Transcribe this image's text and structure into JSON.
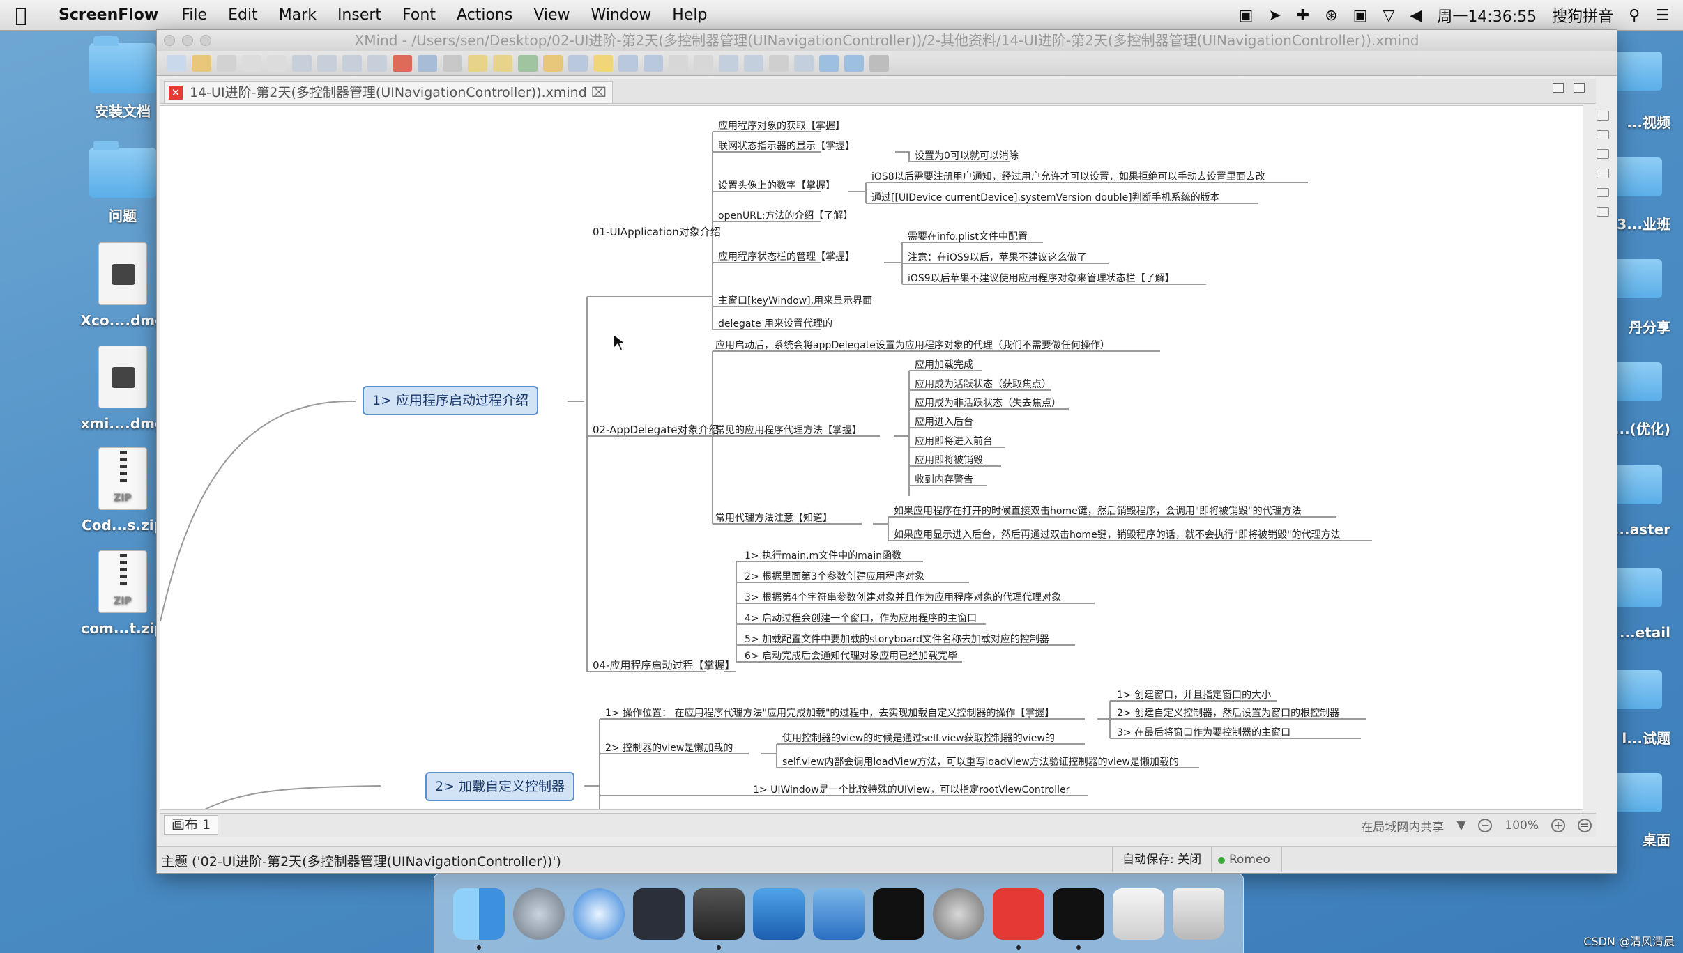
{
  "menubar": {
    "app_name": "ScreenFlow",
    "items": [
      "File",
      "Edit",
      "Mark",
      "Insert",
      "Font",
      "Actions",
      "View",
      "Window",
      "Help"
    ],
    "clock": "周一14:36:55",
    "input_method": "搜狗拼音"
  },
  "desktop": {
    "left_icons": [
      "安装文档",
      "问题",
      "Xco....dmg",
      "xmi....dmg",
      "Cod...s.zip",
      "com...t.zip"
    ],
    "right_labels": [
      "...视频",
      "3...业班",
      "丹分享",
      "...(优化)",
      "...aster",
      "...etail",
      "l...试题",
      "桌面"
    ]
  },
  "window": {
    "title": "XMind - /Users/sen/Desktop/02-UI进阶-第2天(多控制器管理(UINavigationController))/2-其他资料/14-UI进阶-第2天(多控制器管理(UINavigationController)).xmind",
    "tab": "14-UI进阶-第2天(多控制器管理(UINavigationController)).xmind"
  },
  "mindmap": {
    "topic1": "1> 应用程序启动过程介绍",
    "topic2": "2> 加载自定义控制器",
    "b01": "01-UIApplication对象介绍",
    "b01_items": [
      "应用程序对象的获取【掌握】",
      "联网状态指示器的显示【掌握】",
      "设置头像上的数字【掌握】",
      "openURL:方法的介绍【了解】",
      "应用程序状态栏的管理【掌握】",
      "主窗口[keyWindow],用来显示界面",
      "delegate 用来设置代理的"
    ],
    "b01_sub_net": "设置为0可以就可以消除",
    "b01_sub_badge": [
      "iOS8以后需要注册用户通知，经过用户允许才可以设置，如果拒绝可以手动去设置里面去改",
      "通过[[UIDevice currentDevice].systemVersion double]判断手机系统的版本"
    ],
    "b01_sub_status": [
      "需要在info.plist文件中配置",
      "注意：在iOS9以后，苹果不建议这么做了",
      "iOS9以后苹果不建议使用应用程序对象来管理状态栏【了解】"
    ],
    "b02": "02-AppDelegate对象介绍",
    "b02_top": "应用启动后，系统会将appDelegate设置为应用程序对象的代理（我们不需要做任何操作）",
    "b02_common": "常见的应用程序代理方法【掌握】",
    "b02_common_items": [
      "应用加载完成",
      "应用成为活跃状态（获取焦点）",
      "应用成为非活跃状态（失去焦点）",
      "应用进入后台",
      "应用即将进入前台",
      "应用即将被销毁",
      "收到内存警告"
    ],
    "b02_note": "常用代理方法注意【知道】",
    "b02_note_items": [
      "如果应用程序在打开的时候直接双击home键，然后销毁程序，会调用\"即将被销毁\"的代理方法",
      "如果应用显示进入后台，然后再通过双击home键，销毁程序的话，就不会执行\"即将被销毁\"的代理方法"
    ],
    "b04": "04-应用程序启动过程【掌握】",
    "b04_items": [
      "1> 执行main.m文件中的main函数",
      "2> 根据里面第3个参数创建应用程序对象",
      "3> 根据第4个字符串参数创建对象并且作为应用程序对象的代理代理对象",
      "4> 启动过程会创建一个窗口，作为应用程序的主窗口",
      "5> 加载配置文件中要加载的storyboard文件名称去加载对应的控制器",
      "6> 启动完成后会通知代理对象应用已经加载完毕"
    ],
    "t2_pos": "1> 操作位置：  在应用程序代理方法\"应用完成加载\"的过程中，去实现加载自定义控制器的操作【掌握】",
    "t2_pos_items": [
      "1> 创建窗口，并且指定窗口的大小",
      "2> 创建自定义控制器，然后设置为窗口的根控制器",
      "3> 在最后将窗口作为要控制器的主窗口"
    ],
    "t2_lazy": "2> 控制器的view是懒加载的",
    "t2_lazy_items": [
      "使用控制器的view的时候是通过self.view获取控制器的view的",
      "self.view内部会调用loadView方法，可以重写loadView方法验证控制器的view是懒加载的"
    ],
    "t2_window": "1> UIWindow是一个比较特殊的UIView，可以指定rootViewController"
  },
  "sheet": {
    "tab": "画布 1",
    "share": "在局域网内共享",
    "zoom": "100%"
  },
  "statusbar": {
    "topic": "主题 ('02-UI进阶-第2天(多控制器管理(UINavigationController))')",
    "autosave": "自动保存: 关闭",
    "user": "Romeo"
  },
  "dock": {
    "apps": [
      "Finder",
      "Launchpad",
      "Safari",
      "Mouse",
      "ScreenFlow",
      "Xcode",
      "Instruments",
      "Terminal",
      "System Preferences",
      "XMind",
      "Exec",
      "Preview",
      "Trash"
    ]
  },
  "watermark": "CSDN @清风清晨"
}
